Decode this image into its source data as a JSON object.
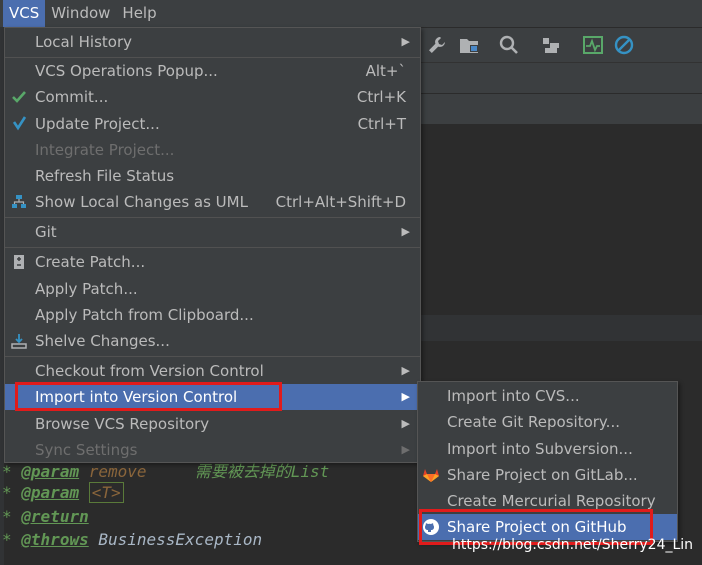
{
  "menubar": {
    "items": [
      {
        "label": "VCS",
        "active": true
      },
      {
        "label": "Window",
        "active": false
      },
      {
        "label": "Help",
        "active": false
      }
    ]
  },
  "vcs_menu": {
    "items": [
      {
        "label": "Local History",
        "submenu": true
      },
      {
        "label": "VCS Operations Popup...",
        "shortcut": "Alt+`"
      },
      {
        "label": "Commit...",
        "shortcut": "Ctrl+K",
        "icon": "checkmark-icon"
      },
      {
        "label": "Update Project...",
        "shortcut": "Ctrl+T",
        "icon": "update-arrow-icon"
      },
      {
        "label": "Integrate Project...",
        "disabled": true
      },
      {
        "label": "Refresh File Status"
      },
      {
        "label": "Show Local Changes as UML",
        "shortcut": "Ctrl+Alt+Shift+D",
        "icon": "uml-diagram-icon"
      },
      {
        "label": "Git",
        "submenu": true
      },
      {
        "label": "Create Patch...",
        "icon": "patch-icon"
      },
      {
        "label": "Apply Patch..."
      },
      {
        "label": "Apply Patch from Clipboard..."
      },
      {
        "label": "Shelve Changes...",
        "icon": "shelve-icon"
      },
      {
        "label": "Checkout from Version Control",
        "submenu": true
      },
      {
        "label": "Import into Version Control",
        "submenu": true,
        "selected": true
      },
      {
        "label": "Browse VCS Repository",
        "submenu": true
      },
      {
        "label": "Sync Settings",
        "submenu": true,
        "disabled": true
      }
    ]
  },
  "import_submenu": {
    "items": [
      {
        "label": "Import into CVS..."
      },
      {
        "label": "Create Git Repository..."
      },
      {
        "label": "Import into Subversion..."
      },
      {
        "label": "Share Project on GitLab...",
        "icon": "gitlab-icon"
      },
      {
        "label": "Create Mercurial Repository"
      },
      {
        "label": "Share Project on GitHub",
        "icon": "github-icon",
        "selected": true
      }
    ]
  },
  "editor": {
    "lines": [
      {
        "star": "*",
        "tag": "@param",
        "rest": " remove",
        "comment": "需要被去掉的List"
      },
      {
        "star": "*",
        "tag": "@param",
        "rest": "",
        "generic": "<T>"
      },
      {
        "star": "*",
        "tag": "@return",
        "rest": ""
      },
      {
        "star": "*",
        "tag": "@throws",
        "rest": " BusinessException"
      }
    ]
  },
  "watermark": "https://blog.csdn.net/Sherry24_Lin",
  "colors": {
    "menu_bg": "#3c3f41",
    "selection": "#4b6eaf",
    "highlight_box": "#e01b1b",
    "editor_bg": "#2b2b2b"
  }
}
